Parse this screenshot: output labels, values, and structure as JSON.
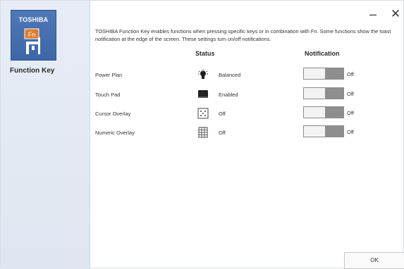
{
  "sidebar": {
    "brand": "TOSHIBA",
    "fn_label": "Fn",
    "app_title": "Function Key"
  },
  "window": {
    "minimize_symbol": "–",
    "close_symbol": "✕"
  },
  "description": "TOSHIBA Function Key enables functions when pressing specific keys or in combination with Fn. Some functions show the toast notification at the edge of the screen. These settings turn on/off notifications.",
  "columns": {
    "status": "Status",
    "notification": "Notification"
  },
  "rows": [
    {
      "label": "Power Plan",
      "status_icon": "lightbulb-icon",
      "status": "Balanced",
      "notification": "Off"
    },
    {
      "label": "Touch Pad",
      "status_icon": "touchpad-icon",
      "status": "Enabled",
      "notification": "Off"
    },
    {
      "label": "Cursor Overlay",
      "status_icon": "cursor-overlay-icon",
      "status": "Off",
      "notification": "Off"
    },
    {
      "label": "Numeric Overlay",
      "status_icon": "numeric-keypad-icon",
      "status": "Off",
      "notification": "Off"
    }
  ],
  "ok_button": "OK",
  "colors": {
    "tile": "#4a73b4",
    "toggle_off": "#8b8b8b",
    "sidebar_bg": "#e3e9f3"
  }
}
